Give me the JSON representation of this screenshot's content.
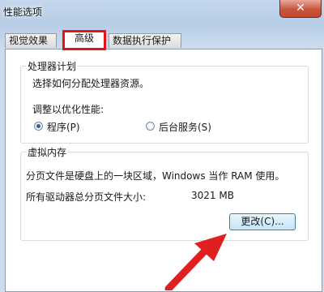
{
  "window": {
    "title": "性能选项",
    "close_glyph": "✕"
  },
  "tabs": [
    {
      "label": "视觉效果",
      "active": false
    },
    {
      "label": "高级",
      "active": true
    },
    {
      "label": "数据执行保护",
      "active": false
    }
  ],
  "processor": {
    "group_title": "处理器计划",
    "description": "选择如何分配处理器资源。",
    "adjust_label": "调整以优化性能:",
    "options": [
      {
        "label": "程序(P)",
        "selected": true
      },
      {
        "label": "后台服务(S)",
        "selected": false
      }
    ]
  },
  "virtual_memory": {
    "group_title": "虚拟内存",
    "description": "分页文件是硬盘上的一块区域，Windows 当作 RAM 使用。",
    "total_label": "所有驱动器总分页文件大小:",
    "total_value": "3021 MB",
    "change_button": "更改(C)..."
  },
  "colors": {
    "highlight": "#e31515",
    "arrow": "#e02020"
  }
}
